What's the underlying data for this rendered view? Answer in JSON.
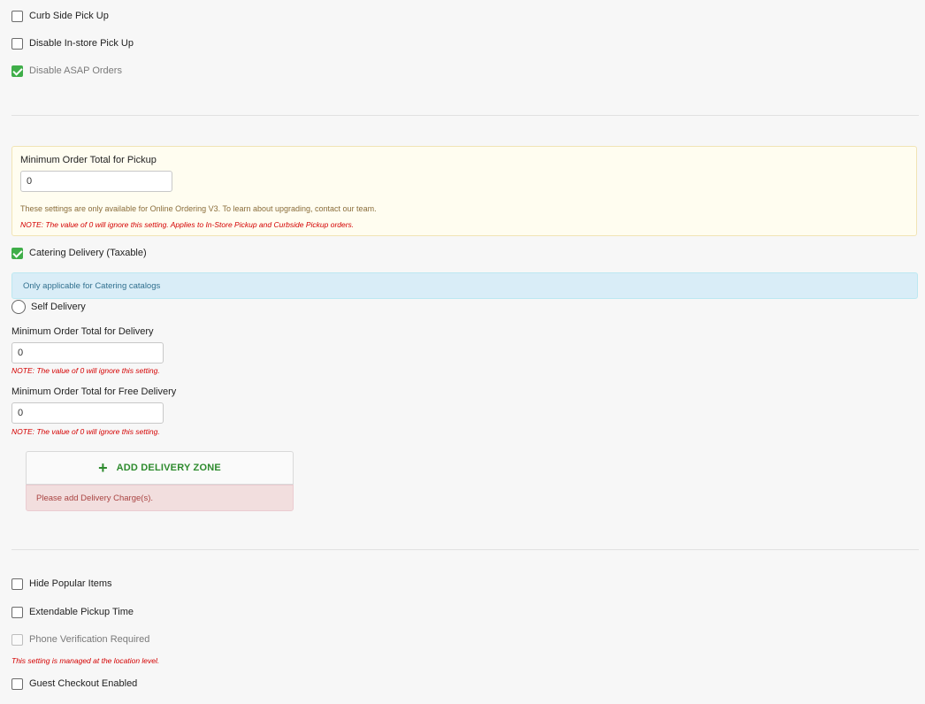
{
  "pickup_options": {
    "curb_side": {
      "label": "Curb Side Pick Up",
      "checked": false
    },
    "disable_instore": {
      "label": "Disable In-store Pick Up",
      "checked": false
    },
    "disable_asap": {
      "label": "Disable ASAP Orders",
      "checked": true
    }
  },
  "pickup_minimum": {
    "label": "Minimum Order Total for Pickup",
    "value": "0",
    "availability_text": "These settings are only available for Online Ordering V3. To learn about upgrading, contact our team.",
    "note": "NOTE: The value of 0 will ignore this setting. Applies to In-Store Pickup and Curbside Pickup orders."
  },
  "catering_delivery": {
    "label": "Catering Delivery (Taxable)",
    "checked": true,
    "info": "Only applicable for Catering catalogs"
  },
  "self_delivery": {
    "label": "Self Delivery",
    "selected": false
  },
  "delivery_minimum": {
    "label": "Minimum Order Total for Delivery",
    "value": "0",
    "note": "NOTE: The value of 0 will ignore this setting."
  },
  "free_delivery_minimum": {
    "label": "Minimum Order Total for Free Delivery",
    "value": "0",
    "note": "NOTE: The value of 0 will ignore this setting."
  },
  "delivery_zone": {
    "button_label": "ADD DELIVERY ZONE",
    "error": "Please add Delivery Charge(s)."
  },
  "misc_options": {
    "hide_popular": {
      "label": "Hide Popular Items",
      "checked": false
    },
    "extendable_pickup": {
      "label": "Extendable Pickup Time",
      "checked": false
    },
    "phone_verification": {
      "label": "Phone Verification Required",
      "checked": false,
      "disabled": true,
      "note": "This setting is managed at the location level."
    },
    "guest_checkout": {
      "label": "Guest Checkout Enabled",
      "checked": false
    }
  },
  "colors": {
    "accent_green": "#3fae49",
    "note_red": "#d40000",
    "info_bg": "#d9edf7",
    "danger_bg": "#f2dede",
    "warning_bg": "#fffdf0"
  }
}
